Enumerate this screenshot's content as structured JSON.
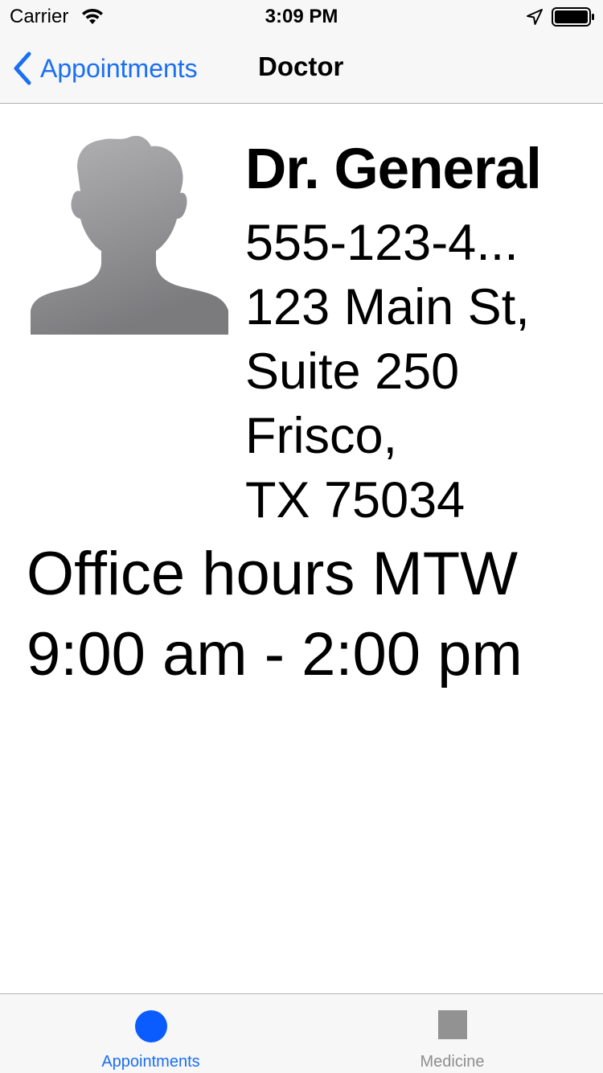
{
  "status_bar": {
    "carrier": "Carrier",
    "time": "3:09 PM",
    "icons": [
      "wifi-icon",
      "location-icon",
      "battery-icon"
    ]
  },
  "nav": {
    "back_label": "Appointments",
    "title": "Doctor"
  },
  "doctor": {
    "avatar_icon": "person-silhouette-icon",
    "name": "Dr. General",
    "phone": "555-123-4...",
    "address": [
      "123 Main St,",
      "Suite 250",
      "Frisco,",
      "TX 75034"
    ],
    "hours": [
      "Office hours MTW",
      "9:00 am - 2:00 pm"
    ]
  },
  "tabs": [
    {
      "label": "Appointments",
      "icon": "circle-icon",
      "selected": true
    },
    {
      "label": "Medicine",
      "icon": "square-icon",
      "selected": false
    }
  ],
  "colors": {
    "accent": "#1a6ff2",
    "tab_selected_icon": "#0b5cff",
    "tab_unselected": "#8e8e8e",
    "bar_background": "#f7f7f7"
  }
}
